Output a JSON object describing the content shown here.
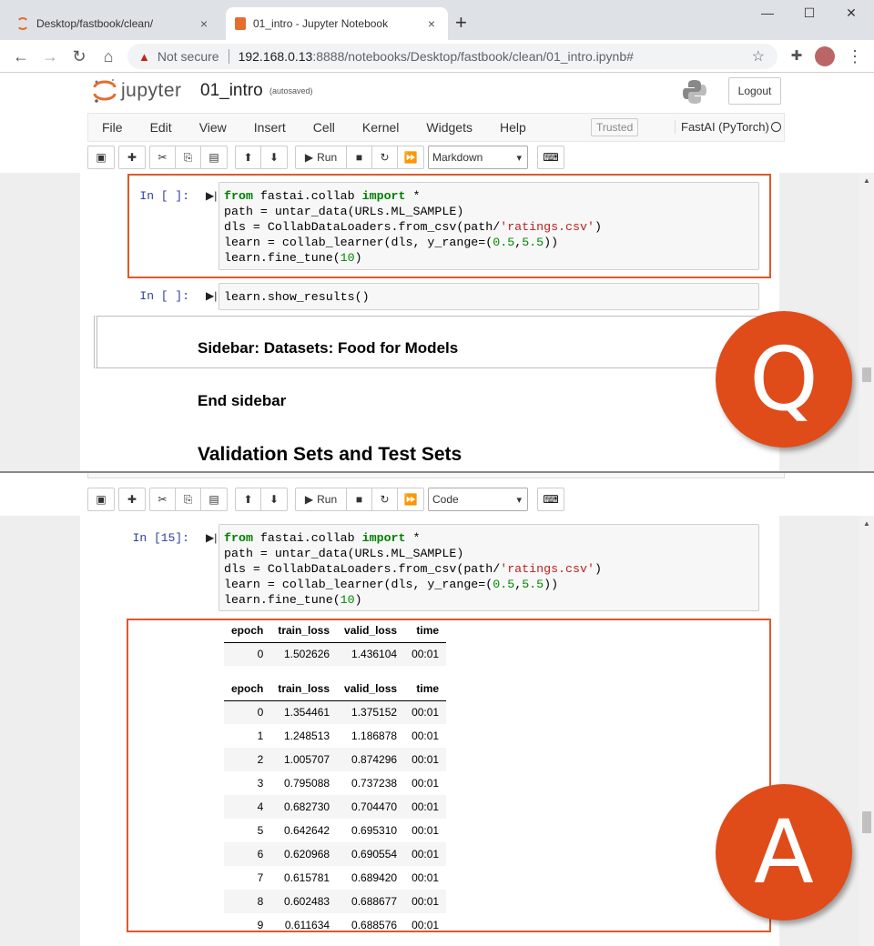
{
  "browser": {
    "tabs": [
      {
        "title": "Desktop/fastbook/clean/",
        "close": "×"
      },
      {
        "title": "01_intro - Jupyter Notebook",
        "close": "×"
      }
    ],
    "new_tab": "+",
    "window_controls": [
      "—",
      "☐",
      "✕"
    ],
    "security_label": "Not secure",
    "url_host": "192.168.0.13",
    "url_path": ":8888/notebooks/Desktop/fastbook/clean/01_intro.ipynb#"
  },
  "jupyter": {
    "brand": "jupyter",
    "notebook_name": "01_intro",
    "autosave": "(autosaved)",
    "logout": "Logout",
    "menu": [
      "File",
      "Edit",
      "View",
      "Insert",
      "Cell",
      "Kernel",
      "Widgets",
      "Help"
    ],
    "trusted": "Trusted",
    "kernel_name": "FastAI (PyTorch)",
    "run_label": "Run",
    "cell_type_top": "Markdown",
    "cell_type_bottom": "Code"
  },
  "top_panel": {
    "cell1_prompt": "In [ ]:",
    "cell2_prompt": "In [ ]:",
    "cell2_code": "learn.show_results()",
    "md_sidebar": "Sidebar: Datasets: Food for Models",
    "md_end": "End sidebar",
    "md_heading": "Validation Sets and Test Sets",
    "badge": "Q"
  },
  "bottom_panel": {
    "cell_prompt": "In [15]:",
    "badge": "A"
  },
  "code_lines": {
    "l1a": "from",
    "l1b": " fastai.collab ",
    "l1c": "import",
    "l1d": " *",
    "l2": "path = untar_data(URLs.ML_SAMPLE)",
    "l3a": "dls = CollabDataLoaders.from_csv(path/",
    "l3b": "'ratings.csv'",
    "l3c": ")",
    "l4a": "learn = collab_learner(dls, y_range=(",
    "l4b": "0.5",
    "l4c": ",",
    "l4d": "5.5",
    "l4e": "))",
    "l5a": "learn.fine_tune(",
    "l5b": "10",
    "l5c": ")"
  },
  "results": {
    "headers": [
      "epoch",
      "train_loss",
      "valid_loss",
      "time"
    ],
    "table1": [
      [
        "0",
        "1.502626",
        "1.436104",
        "00:01"
      ]
    ],
    "table2": [
      [
        "0",
        "1.354461",
        "1.375152",
        "00:01"
      ],
      [
        "1",
        "1.248513",
        "1.186878",
        "00:01"
      ],
      [
        "2",
        "1.005707",
        "0.874296",
        "00:01"
      ],
      [
        "3",
        "0.795088",
        "0.737238",
        "00:01"
      ],
      [
        "4",
        "0.682730",
        "0.704470",
        "00:01"
      ],
      [
        "5",
        "0.642642",
        "0.695310",
        "00:01"
      ],
      [
        "6",
        "0.620968",
        "0.690554",
        "00:01"
      ],
      [
        "7",
        "0.615781",
        "0.689420",
        "00:01"
      ],
      [
        "8",
        "0.602483",
        "0.688677",
        "00:01"
      ],
      [
        "9",
        "0.611634",
        "0.688576",
        "00:01"
      ]
    ]
  },
  "colors": {
    "accent": "#df4c1a",
    "prompt": "#303f9f",
    "keyword": "#008000",
    "string": "#ba2121"
  }
}
